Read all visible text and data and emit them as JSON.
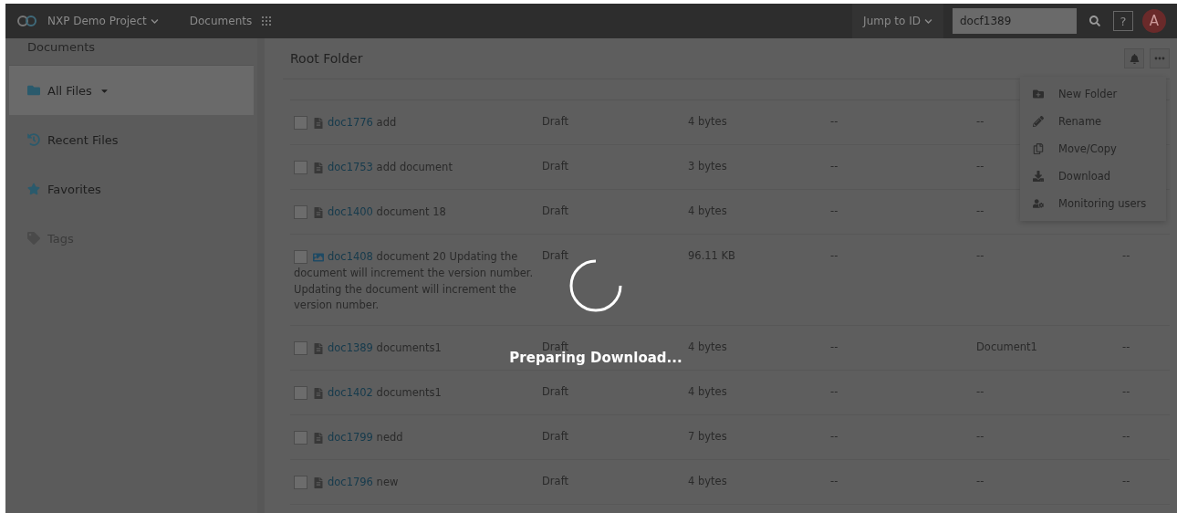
{
  "topbar": {
    "project": "NXP Demo Project",
    "section": "Documents",
    "jump_label": "Jump to ID",
    "search_value": "docf1389",
    "help": "?",
    "avatar": "A"
  },
  "sidebar": {
    "title": "Documents",
    "items": [
      {
        "label": "All Files",
        "selected": true,
        "disabled": false,
        "has_caret": true
      },
      {
        "label": "Recent Files",
        "selected": false,
        "disabled": false,
        "has_caret": false
      },
      {
        "label": "Favorites",
        "selected": false,
        "disabled": false,
        "has_caret": false
      },
      {
        "label": "Tags",
        "selected": false,
        "disabled": true,
        "has_caret": false
      }
    ]
  },
  "folder": {
    "title": "Root Folder"
  },
  "rows": [
    {
      "checked": false,
      "kind": "text",
      "id": "doc1776",
      "title": "add",
      "status": "Draft",
      "size": "4 bytes",
      "column_4": "--",
      "column_5": "--"
    },
    {
      "checked": false,
      "kind": "text",
      "id": "doc1753",
      "title": "add document",
      "status": "Draft",
      "size": "3 bytes",
      "column_4": "--",
      "column_5": "--"
    },
    {
      "checked": false,
      "kind": "text",
      "id": "doc1400",
      "title": "document 18",
      "status": "Draft",
      "size": "4 bytes",
      "column_4": "--",
      "column_5": "--"
    },
    {
      "checked": false,
      "kind": "image",
      "id": "doc1408",
      "title": "document 20 Updating the document will increment the version number. Updating the document will increment the version number.",
      "status": "Draft",
      "size": "96.11 KB",
      "column_4": "--",
      "column_5": "--",
      "column_6": "--"
    },
    {
      "checked": false,
      "kind": "text",
      "id": "doc1389",
      "title": "documents1",
      "status": "Draft",
      "size": "4 bytes",
      "column_4": "--",
      "column_5": "Document1",
      "column_6": "--"
    },
    {
      "checked": false,
      "kind": "text",
      "id": "doc1402",
      "title": "documents1",
      "status": "Draft",
      "size": "4 bytes",
      "column_4": "--",
      "column_5": "--",
      "column_6": "--"
    },
    {
      "checked": false,
      "kind": "text",
      "id": "doc1799",
      "title": "nedd",
      "status": "Draft",
      "size": "7 bytes",
      "column_4": "--",
      "column_5": "--",
      "column_6": "--"
    },
    {
      "checked": false,
      "kind": "text",
      "id": "doc1796",
      "title": "new",
      "status": "Draft",
      "size": "4 bytes",
      "column_4": "--",
      "column_5": "--",
      "column_6": "--"
    }
  ],
  "menu": [
    {
      "label": "New Folder"
    },
    {
      "label": "Rename"
    },
    {
      "label": "Move/Copy"
    },
    {
      "label": "Download"
    },
    {
      "label": "Monitoring users"
    }
  ],
  "loading": {
    "message": "Preparing Download..."
  }
}
